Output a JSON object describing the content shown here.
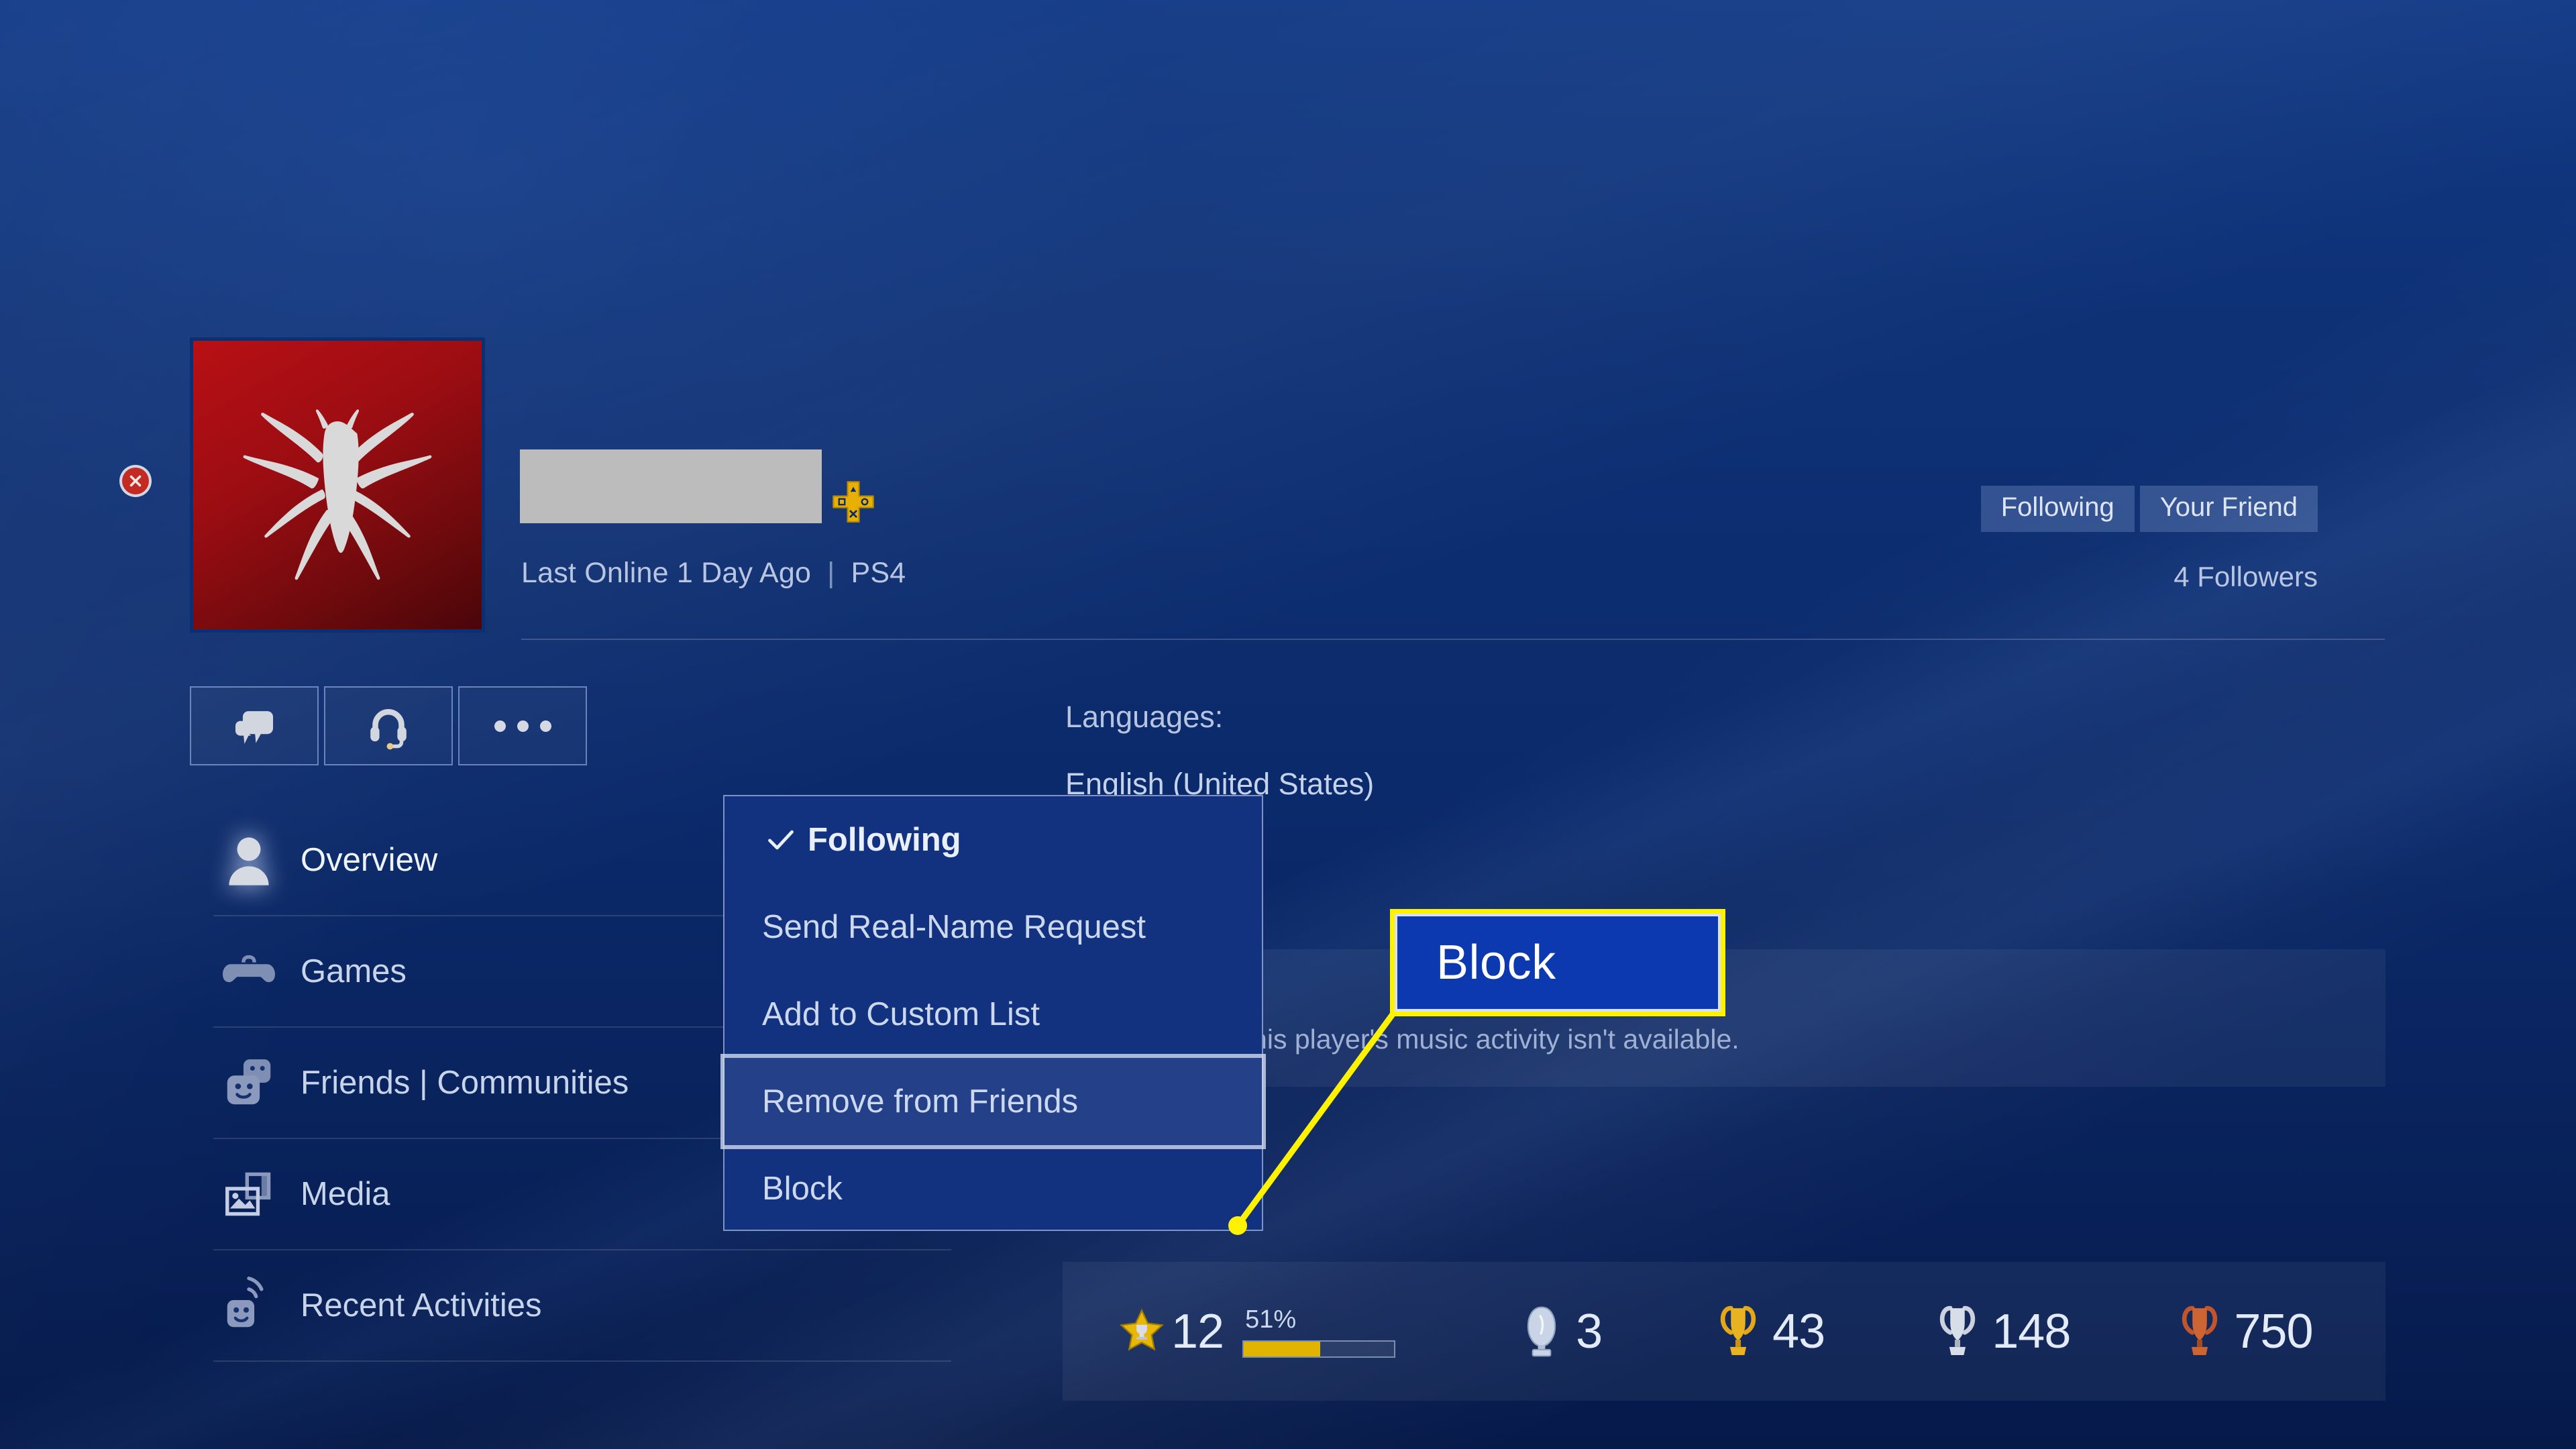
{
  "profile": {
    "avatar_icon": "spiderman-logo",
    "name_redacted": true,
    "ps_plus_icon": "ps-plus-icon",
    "last_online": "Last Online 1 Day Ago",
    "separator": "|",
    "platform": "PS4",
    "followers": "4 Followers",
    "close_icon": "close-circle-icon"
  },
  "header_buttons": [
    {
      "label": "Following",
      "name": "following-button"
    },
    {
      "label": "Your Friend",
      "name": "your-friend-button"
    }
  ],
  "action_buttons": [
    {
      "icon": "message-bubbles-icon",
      "name": "message-button"
    },
    {
      "icon": "headset-icon",
      "name": "party-chat-button"
    },
    {
      "icon": "ellipsis-icon",
      "name": "more-options-button"
    }
  ],
  "sidebar": {
    "items": [
      {
        "label": "Overview",
        "icon": "person-icon",
        "active": true
      },
      {
        "label": "Games",
        "icon": "controller-icon",
        "active": false
      },
      {
        "label": "Friends | Communities",
        "icon": "friends-icon",
        "active": false
      },
      {
        "label": "Media",
        "icon": "media-icon",
        "active": false
      },
      {
        "label": "Recent Activities",
        "icon": "activity-icon",
        "active": false
      }
    ]
  },
  "content": {
    "languages_label": "Languages:",
    "languages_value": "English (United States)",
    "music_activity": "This player's music activity isn't available."
  },
  "trophies": {
    "level_icon": "trophy-star-icon",
    "level": "12",
    "progress_percent": "51%",
    "progress_value": 51,
    "platinum_icon": "platinum-trophy-icon",
    "platinum": "3",
    "gold_icon": "gold-trophy-icon",
    "gold": "43",
    "silver_icon": "silver-trophy-icon",
    "silver": "148",
    "bronze_icon": "bronze-trophy-icon",
    "bronze": "750"
  },
  "dropdown": {
    "items": [
      {
        "label": "Following",
        "checked": true,
        "selected": false,
        "check_icon": "checkmark-icon"
      },
      {
        "label": "Send Real-Name Request",
        "checked": false,
        "selected": false
      },
      {
        "label": "Add to Custom List",
        "checked": false,
        "selected": false
      },
      {
        "label": "Remove from Friends",
        "checked": false,
        "selected": true
      },
      {
        "label": "Block",
        "checked": false,
        "selected": false
      }
    ]
  },
  "callout": {
    "label": "Block",
    "border_color": "#fff200",
    "fill_color": "#0c39b0"
  },
  "colors": {
    "background_blue": "#0b2a6b",
    "panel_tint": "rgba(255,255,255,0.055)",
    "accent_yellow": "#fff200",
    "progress_gold": "#e0b400",
    "avatar_red": "#b81015"
  }
}
